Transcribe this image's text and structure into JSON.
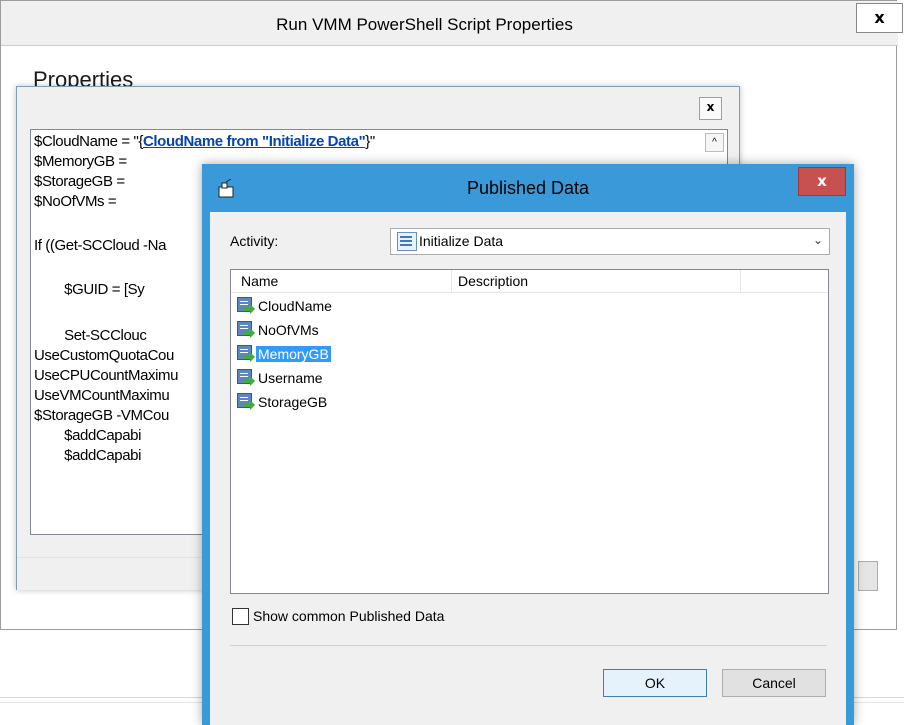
{
  "outer_window": {
    "title": "Run VMM PowerShell Script Properties",
    "close_label": "x",
    "heading": "Properties"
  },
  "script_dialog": {
    "close_label": "x",
    "scroll_up": "^",
    "lines": [
      {
        "pre": "$CloudName = \"{",
        "link": "CloudName from \"Initialize Data\"",
        "post": "}\""
      },
      {
        "pre": "$MemoryGB =",
        "link": "",
        "post": ""
      },
      {
        "pre": "$StorageGB =",
        "link": "",
        "post": ""
      },
      {
        "pre": "$NoOfVMs =",
        "link": "",
        "post": ""
      },
      {
        "pre": "If ((Get-SCCloud -Na",
        "link": "",
        "post": ""
      },
      {
        "pre": "        $GUID = [Sy",
        "link": "",
        "post": ""
      },
      {
        "pre": "        Set-SCClouc",
        "link": "",
        "post": ""
      },
      {
        "pre": "UseCustomQuotaCou",
        "link": "",
        "post": ""
      },
      {
        "pre": "UseCPUCountMaximu",
        "link": "",
        "post": ""
      },
      {
        "pre": "UseVMCountMaximu",
        "link": "",
        "post": ""
      },
      {
        "pre": "$StorageGB -VMCou",
        "link": "",
        "post": ""
      },
      {
        "pre": "        $addCapabi",
        "link": "",
        "post": ""
      },
      {
        "pre": "        $addCapabi",
        "link": "",
        "post": ""
      }
    ]
  },
  "published_data": {
    "title": "Published Data",
    "close_label": "x",
    "activity_label": "Activity:",
    "activity_value": "Initialize Data",
    "columns": [
      "Name",
      "Description"
    ],
    "rows": [
      {
        "name": "CloudName",
        "selected": false
      },
      {
        "name": "NoOfVMs",
        "selected": false
      },
      {
        "name": "MemoryGB",
        "selected": true
      },
      {
        "name": "Username",
        "selected": false
      },
      {
        "name": "StorageGB",
        "selected": false
      }
    ],
    "show_common_label": "Show common Published Data",
    "show_common_checked": false,
    "ok_label": "OK",
    "cancel_label": "Cancel"
  },
  "colors": {
    "accent_frame": "#3a9ad9",
    "selection": "#3399ff",
    "close_red": "#c75050",
    "link": "#0645ad"
  }
}
